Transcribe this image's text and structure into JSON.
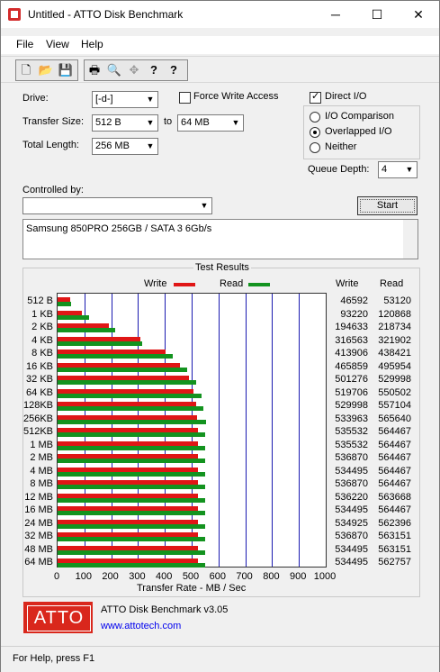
{
  "window": {
    "title": "Untitled - ATTO Disk Benchmark",
    "minimize": "─",
    "maximize": "☐",
    "close": "✕"
  },
  "menu": [
    "File",
    "View",
    "Help"
  ],
  "toolbar": {
    "icons": [
      "new-icon",
      "open-icon",
      "save-icon",
      "print-icon",
      "print-preview-icon",
      "move-icon",
      "help-icon",
      "context-help-icon"
    ],
    "glyphs": [
      "🗋",
      "📂",
      "💾",
      "🖶",
      "🔍",
      "✥",
      "?",
      "?"
    ]
  },
  "settings": {
    "drive_label": "Drive:",
    "drive_value": "[-d-]",
    "force_write_label": "Force Write Access",
    "force_write_checked": false,
    "direct_io_label": "Direct I/O",
    "direct_io_checked": true,
    "transfer_size_label": "Transfer Size:",
    "transfer_from": "512 B",
    "to_label": "to",
    "transfer_to": "64 MB",
    "total_length_label": "Total Length:",
    "total_length_value": "256 MB",
    "io_options": [
      "I/O Comparison",
      "Overlapped I/O",
      "Neither"
    ],
    "io_selected": 1,
    "queue_depth_label": "Queue Depth:",
    "queue_depth_value": "4",
    "controlled_by_label": "Controlled by:",
    "controlled_by_value": "",
    "start_label": "Start"
  },
  "description": "Samsung 850PRO 256GB / SATA 3 6Gb/s",
  "results": {
    "group_title": "Test Results",
    "write_label": "Write",
    "read_label": "Read",
    "col_write": "Write",
    "col_read": "Read",
    "xlabel": "Transfer Rate - MB / Sec",
    "footer_app": "ATTO Disk Benchmark v3.05",
    "footer_url": "www.attotech.com",
    "logo_text": "ATTO"
  },
  "chart_data": {
    "type": "bar",
    "orientation": "horizontal",
    "categories": [
      "512 B",
      "1 KB",
      "2 KB",
      "4 KB",
      "8 KB",
      "16 KB",
      "32 KB",
      "64 KB",
      "128KB",
      "256KB",
      "512KB",
      "1 MB",
      "2 MB",
      "4 MB",
      "8 MB",
      "12 MB",
      "16 MB",
      "24 MB",
      "32 MB",
      "48 MB",
      "64 MB"
    ],
    "series": [
      {
        "name": "Write",
        "color": "#e01616",
        "values": [
          46592,
          93220,
          194633,
          316563,
          413906,
          465859,
          501276,
          519706,
          529998,
          533963,
          535532,
          535532,
          536870,
          534495,
          536870,
          536220,
          534495,
          534925,
          536870,
          534495,
          534495
        ]
      },
      {
        "name": "Read",
        "color": "#13931f",
        "values": [
          53120,
          120868,
          218734,
          321902,
          438421,
          495954,
          529998,
          550502,
          557104,
          565640,
          564467,
          564467,
          564467,
          564467,
          564467,
          563668,
          564467,
          562396,
          563151,
          563151,
          562757
        ]
      }
    ],
    "xlim": [
      0,
      1000
    ],
    "xticks": [
      "0",
      "100",
      "200",
      "300",
      "400",
      "500",
      "600",
      "700",
      "800",
      "900",
      "1000"
    ],
    "xlabel": "Transfer Rate - MB / Sec",
    "legend": "top",
    "value_units": "KB/s"
  },
  "statusbar": "For Help, press F1"
}
